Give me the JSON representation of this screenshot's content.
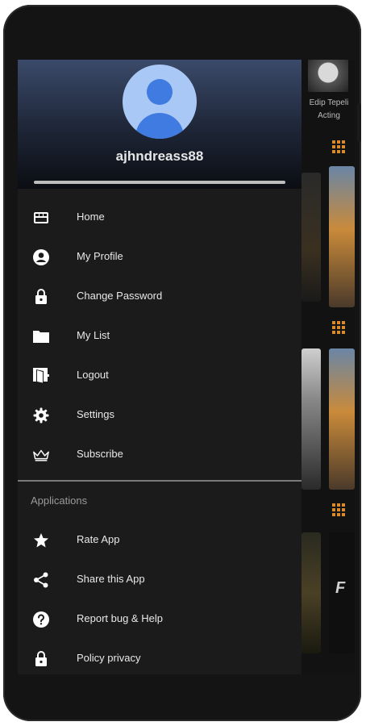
{
  "background": {
    "actor_name": "Edip Tepeli",
    "actor_role": "Acting"
  },
  "drawer": {
    "username": "ajhndreass88",
    "menu": [
      {
        "label": "Home",
        "icon": "home-icon"
      },
      {
        "label": "My Profile",
        "icon": "account-circle-icon"
      },
      {
        "label": "Change Password",
        "icon": "lock-icon"
      },
      {
        "label": "My List",
        "icon": "folder-icon"
      },
      {
        "label": "Logout",
        "icon": "logout-door-icon"
      },
      {
        "label": "Settings",
        "icon": "gear-icon"
      },
      {
        "label": "Subscribe",
        "icon": "crown-icon"
      }
    ],
    "section_title": "Applications",
    "apps_menu": [
      {
        "label": "Rate App",
        "icon": "star-icon"
      },
      {
        "label": "Share this App",
        "icon": "share-icon"
      },
      {
        "label": "Report bug & Help",
        "icon": "help-circle-icon"
      },
      {
        "label": "Policy privacy",
        "icon": "lock-icon"
      }
    ]
  },
  "colors": {
    "drawer_bg": "#1b1b1b",
    "accent_orange": "#d98a2b",
    "avatar_blue": "#3f7be0"
  }
}
